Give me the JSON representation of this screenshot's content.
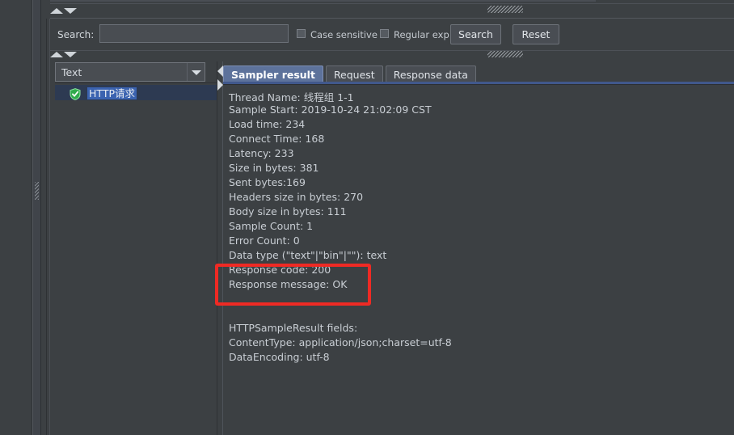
{
  "search_panel": {
    "label": "Search:",
    "input_value": "",
    "input_placeholder": "",
    "case_sensitive_label": "Case sensitive",
    "case_sensitive_checked": false,
    "regular_exp_label": "Regular exp.",
    "regular_exp_checked": false,
    "search_button": "Search",
    "reset_button": "Reset"
  },
  "tree_panel": {
    "renderer_selected": "Text",
    "items": [
      {
        "label": "HTTP请求",
        "icon": "shield-success-icon",
        "selected": true
      }
    ]
  },
  "tabs": [
    {
      "label": "Sampler result",
      "active": true
    },
    {
      "label": "Request",
      "active": false
    },
    {
      "label": "Response data",
      "active": false
    }
  ],
  "sampler_result": {
    "lines": [
      "Thread Name: 线程组 1-1",
      "Sample Start: 2019-10-24 21:02:09 CST",
      "Load time: 234",
      "Connect Time: 168",
      "Latency: 233",
      "Size in bytes: 381",
      "Sent bytes:169",
      "Headers size in bytes: 270",
      "Body size in bytes: 111",
      "Sample Count: 1",
      "Error Count: 0",
      "Data type (\"text\"|\"bin\"|\"\"): text",
      "Response code: 200",
      "Response message: OK",
      "",
      "",
      "HTTPSampleResult fields:",
      "ContentType: application/json;charset=utf-8",
      "DataEncoding: utf-8"
    ]
  },
  "annotation": {
    "highlight_color": "#ef2a24",
    "highlighted_lines": [
      "Response code: 200",
      "Response message: OK"
    ]
  },
  "colors": {
    "background": "#3c4043",
    "panel": "#3c4043",
    "active_tab": "#5d729b",
    "selection": "#3b63b0",
    "text": "#c9ced4",
    "accent_underline": "#41588c"
  }
}
